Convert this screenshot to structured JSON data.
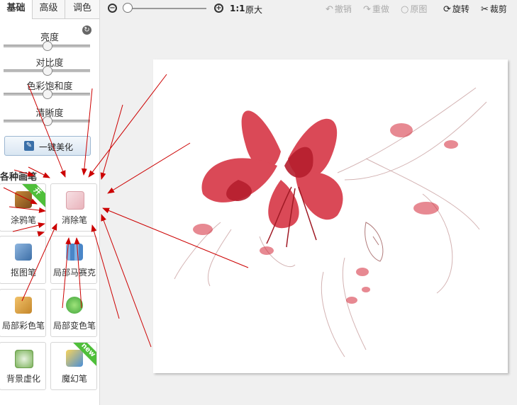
{
  "tabs": [
    {
      "label": "基础",
      "active": true
    },
    {
      "label": "高级",
      "active": false
    },
    {
      "label": "调色",
      "active": false
    }
  ],
  "adjustments": {
    "reset_icon": "refresh-icon",
    "sliders": [
      {
        "label": "亮度",
        "value_fraction": 0.5
      },
      {
        "label": "对比度",
        "value_fraction": 0.5
      },
      {
        "label": "色彩饱和度",
        "value_fraction": 0.5
      },
      {
        "label": "清晰度",
        "value_fraction": 0.5
      }
    ]
  },
  "beautify_button": {
    "label": "一键美化",
    "icon": "magic-wand-icon"
  },
  "brushes": {
    "title": "各种画笔",
    "tools": [
      {
        "label": "涂鸦笔",
        "icon": "paintbrush-icon",
        "badge": "开"
      },
      {
        "label": "消除笔",
        "icon": "eraser-icon",
        "badge": ""
      },
      {
        "label": "抠图笔",
        "icon": "pen-icon",
        "badge": ""
      },
      {
        "label": "局部马赛克",
        "icon": "mosaic-icon",
        "badge": ""
      },
      {
        "label": "局部彩色笔",
        "icon": "color-brush-icon",
        "badge": ""
      },
      {
        "label": "局部变色笔",
        "icon": "color-change-icon",
        "badge": ""
      },
      {
        "label": "背景虚化",
        "icon": "blur-icon",
        "badge": ""
      },
      {
        "label": "魔幻笔",
        "icon": "magic-pen-icon",
        "badge": "new"
      }
    ]
  },
  "toolbar": {
    "zoom_out_icon": "zoom-out-icon",
    "zoom_in_icon": "zoom-in-icon",
    "ratio_label": "1:1",
    "original_size_label": "原大",
    "undo_label": "撤销",
    "redo_label": "重做",
    "original_label": "原图",
    "rotate_label": "旋转",
    "crop_label": "裁剪"
  },
  "colors": {
    "accent": "#3a6fa8",
    "annotation_arrow": "#cc0000",
    "new_badge": "#4fbf3a",
    "flower": "#d42a3a"
  }
}
